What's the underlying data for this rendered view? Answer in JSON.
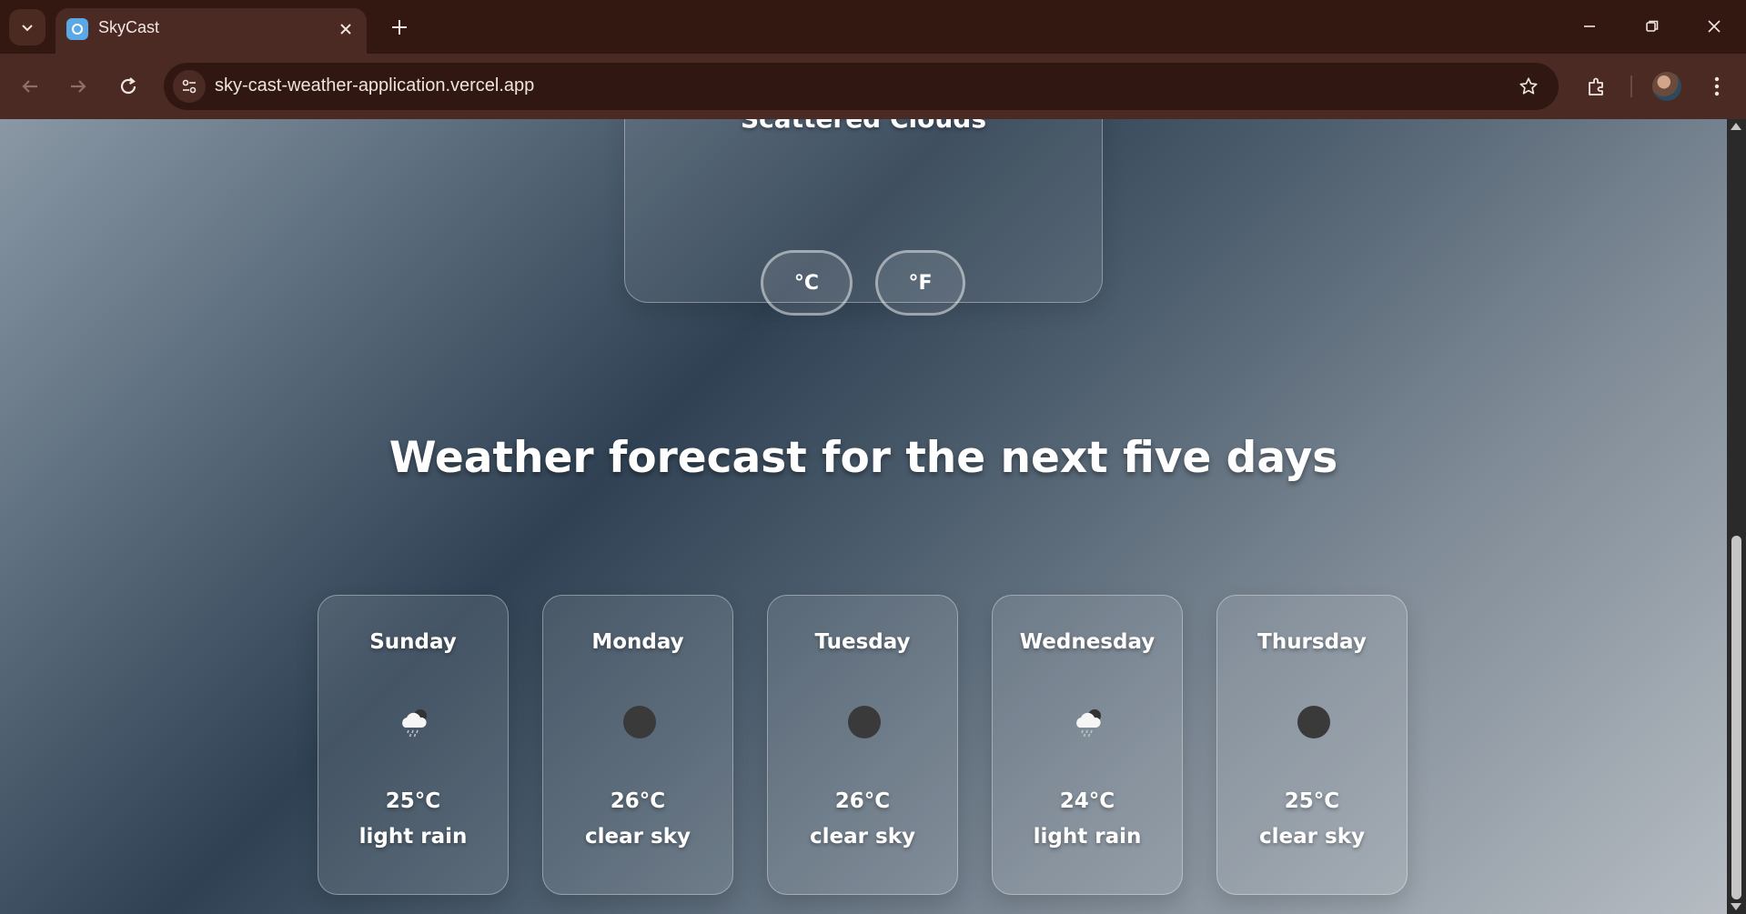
{
  "browser": {
    "tab_title": "SkyCast",
    "url": "sky-cast-weather-application.vercel.app"
  },
  "current": {
    "description": "Scattered Clouds"
  },
  "units": {
    "celsius_label": "°C",
    "fahrenheit_label": "°F"
  },
  "forecast": {
    "heading": "Weather forecast for the next five days",
    "days": [
      {
        "day": "Sunday",
        "temp": "25°C",
        "desc": "light rain",
        "icon": "rain-cloud-icon"
      },
      {
        "day": "Monday",
        "temp": "26°C",
        "desc": "clear sky",
        "icon": "clear-sky-icon"
      },
      {
        "day": "Tuesday",
        "temp": "26°C",
        "desc": "clear sky",
        "icon": "clear-sky-icon"
      },
      {
        "day": "Wednesday",
        "temp": "24°C",
        "desc": "light rain",
        "icon": "rain-cloud-icon"
      },
      {
        "day": "Thursday",
        "temp": "25°C",
        "desc": "clear sky",
        "icon": "clear-sky-icon"
      }
    ]
  },
  "colors": {
    "chrome_dark": "#321811",
    "chrome_toolbar": "#4a2a22",
    "text_white": "#ffffff"
  }
}
